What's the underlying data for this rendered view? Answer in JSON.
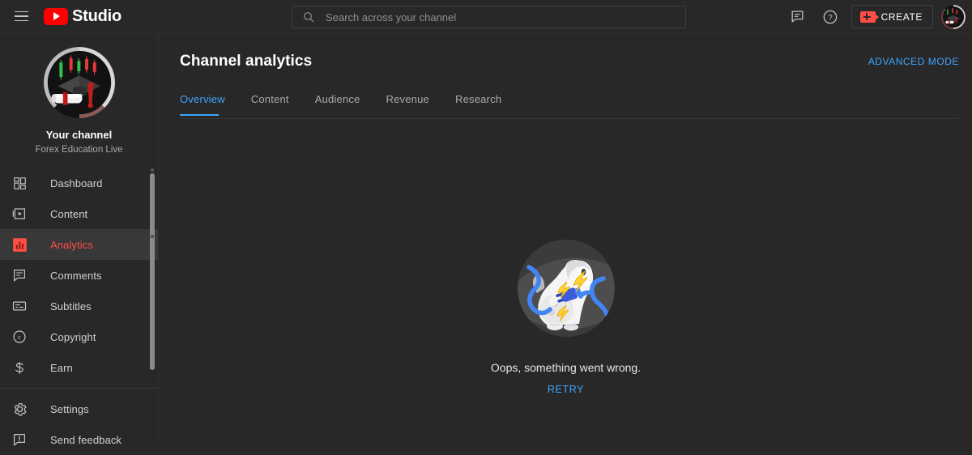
{
  "topbar": {
    "menu_icon": "hamburger-icon",
    "logo_icon": "youtube-logo-icon",
    "brand": "Studio",
    "search": {
      "placeholder": "Search across your channel",
      "value": "",
      "icon": "search-icon"
    },
    "feedback_icon": "comment-icon",
    "help_icon": "help-circle-icon",
    "create": {
      "label": "CREATE",
      "icon": "video-camera-plus-icon"
    },
    "avatar": "account-avatar"
  },
  "sidebar": {
    "channel": {
      "avatar": "channel-avatar",
      "title": "Your channel",
      "subtitle": "Forex Education Live"
    },
    "items": [
      {
        "label": "Dashboard",
        "icon": "dashboard-icon",
        "active": false
      },
      {
        "label": "Content",
        "icon": "content-icon",
        "active": false
      },
      {
        "label": "Analytics",
        "icon": "analytics-icon",
        "active": true
      },
      {
        "label": "Comments",
        "icon": "comments-icon",
        "active": false
      },
      {
        "label": "Subtitles",
        "icon": "subtitles-icon",
        "active": false
      },
      {
        "label": "Copyright",
        "icon": "copyright-icon",
        "active": false
      },
      {
        "label": "Earn",
        "icon": "earn-icon",
        "active": false
      }
    ],
    "bottom_items": [
      {
        "label": "Settings",
        "icon": "gear-icon"
      },
      {
        "label": "Send feedback",
        "icon": "feedback-icon"
      }
    ]
  },
  "main": {
    "title": "Channel analytics",
    "advanced_mode": "ADVANCED MODE",
    "tabs": [
      {
        "label": "Overview",
        "active": true
      },
      {
        "label": "Content",
        "active": false
      },
      {
        "label": "Audience",
        "active": false
      },
      {
        "label": "Revenue",
        "active": false
      },
      {
        "label": "Research",
        "active": false
      }
    ],
    "error": {
      "illustration": "error-monkey-unplugged-illustration",
      "message": "Oops, something went wrong.",
      "retry_label": "RETRY"
    }
  },
  "colors": {
    "background": "#282828",
    "accent_blue": "#3ea6ff",
    "brand_red": "#ff0000",
    "active_red": "#ff4e45",
    "text_primary": "#ffffff",
    "text_secondary": "#aaaaaa"
  }
}
